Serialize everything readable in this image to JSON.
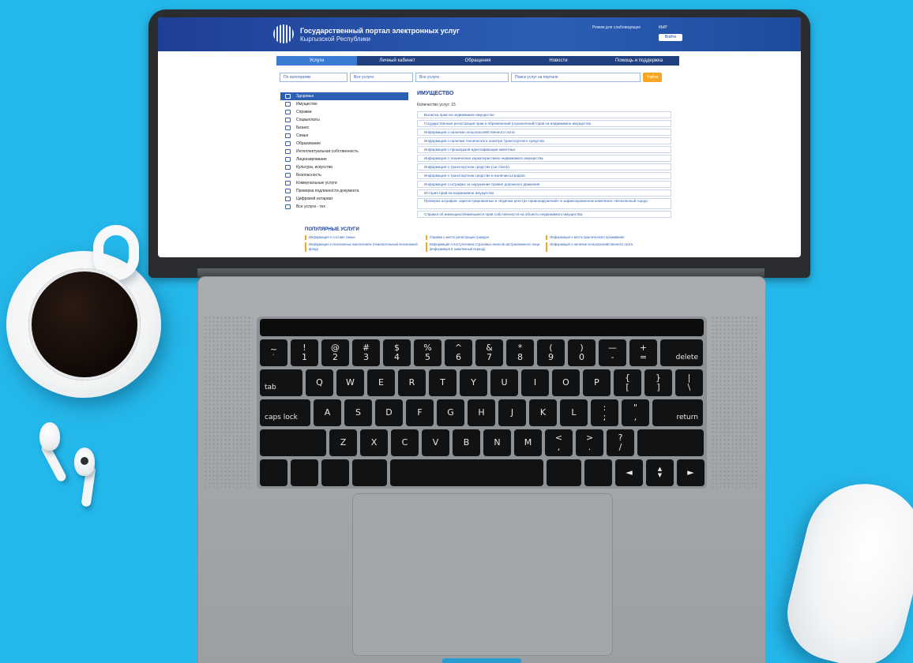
{
  "portal": {
    "title": "Государственный портал электронных услуг",
    "subtitle": "Кыргызской Республики",
    "accessibility_link": "Режим для слабовидящих",
    "language": "КЫР",
    "login_button": "Войти"
  },
  "nav": {
    "tabs": [
      "Услуги",
      "Личный кабинет",
      "Обращения",
      "Новости",
      "Помощь и поддержка"
    ]
  },
  "search": {
    "category": "По категориям",
    "all_services_1": "Все услуги",
    "all_services_2": "Все услуги",
    "placeholder": "Поиск услуг на портале",
    "button": "Найти"
  },
  "sidebar": {
    "items": [
      "Здоровье",
      "Имущество",
      "Справки",
      "Соцвыплаты",
      "Бизнес",
      "Семья",
      "Образование",
      "Интеллектуальная собственность",
      "Лицензирование",
      "Культура, искусство",
      "Безопасность",
      "Коммунальные услуги",
      "Проверка подлинности документа",
      "Цифровой нотариат",
      "Все услуги - тех"
    ]
  },
  "content": {
    "title": "ИМУЩЕСТВО",
    "count_label": "Количество услуг:",
    "count_value": "15",
    "services": [
      "Выписка прав на недвижимое имущество",
      "Государственная регистрация прав и обременений (ограничений) прав на недвижимое имущество",
      "Информация о наличии сельскохозяйственного скота",
      "Информация о наличии технического осмотра транспортного средства",
      "Информация о прошедшей идентификации животных",
      "Информация о технических характеристиках недвижимого имущества",
      "Информация о транспортном средстве (car check)",
      "Информация о транспортном средстве и наличии штрафов",
      "Информация о штрафах за нарушение правил дорожного движения",
      "История прав на недвижимое имущество",
      "Проверка штрафов, зарегистрированных в «Едином реестре правонарушений» в зафиксированном комплексе «Безопасный город»",
      "Справка об имеющихся/имевшихся прав собственности на объекты недвижимого имущества"
    ]
  },
  "popular": {
    "title": "ПОПУЛЯРНЫЕ УСЛУГИ",
    "items": [
      "Информация о составе семьи",
      "Справка о месте регистрации граждан",
      "Информация о месте фактического проживания",
      "Информация о пенсионных накоплениях (Накопительный пенсионный фонд)",
      "Информация о поступлениях страховых взносов застрахованного лица (информация в заявленный период)",
      "Информация о наличии сельскохозяйственного скота"
    ]
  },
  "keyboard": {
    "row1": [
      [
        "~",
        "`"
      ],
      [
        "!",
        "1"
      ],
      [
        "@",
        "2"
      ],
      [
        "#",
        "3"
      ],
      [
        "$",
        "4"
      ],
      [
        "%",
        "5"
      ],
      [
        "^",
        "6"
      ],
      [
        "&",
        "7"
      ],
      [
        "*",
        "8"
      ],
      [
        "(",
        "9"
      ],
      [
        ")",
        "0"
      ],
      [
        "—",
        "-"
      ],
      [
        "+",
        "="
      ]
    ],
    "delete": "delete",
    "tab": "tab",
    "row2": [
      "Q",
      "W",
      "E",
      "R",
      "T",
      "Y",
      "U",
      "I",
      "O",
      "P"
    ],
    "row2_end": [
      [
        "{",
        "["
      ],
      [
        "}",
        "]"
      ],
      [
        "|",
        "\\"
      ]
    ],
    "caps": "caps lock",
    "row3": [
      "A",
      "S",
      "D",
      "F",
      "G",
      "H",
      "J",
      "K",
      "L"
    ],
    "row3_end": [
      [
        ":",
        ";"
      ],
      [
        "\"",
        ","
      ]
    ],
    "return": "return",
    "row4": [
      "Z",
      "X",
      "C",
      "V",
      "B",
      "N",
      "M"
    ],
    "row4_end": [
      [
        "<",
        ","
      ],
      [
        ">",
        "."
      ],
      [
        "?",
        "/"
      ]
    ],
    "arrows": [
      "◄",
      "▲",
      "▼",
      "►"
    ]
  },
  "colors": {
    "background": "#24b7ea",
    "portal_blue": "#1f3e96",
    "accent_orange": "#f5a623"
  }
}
